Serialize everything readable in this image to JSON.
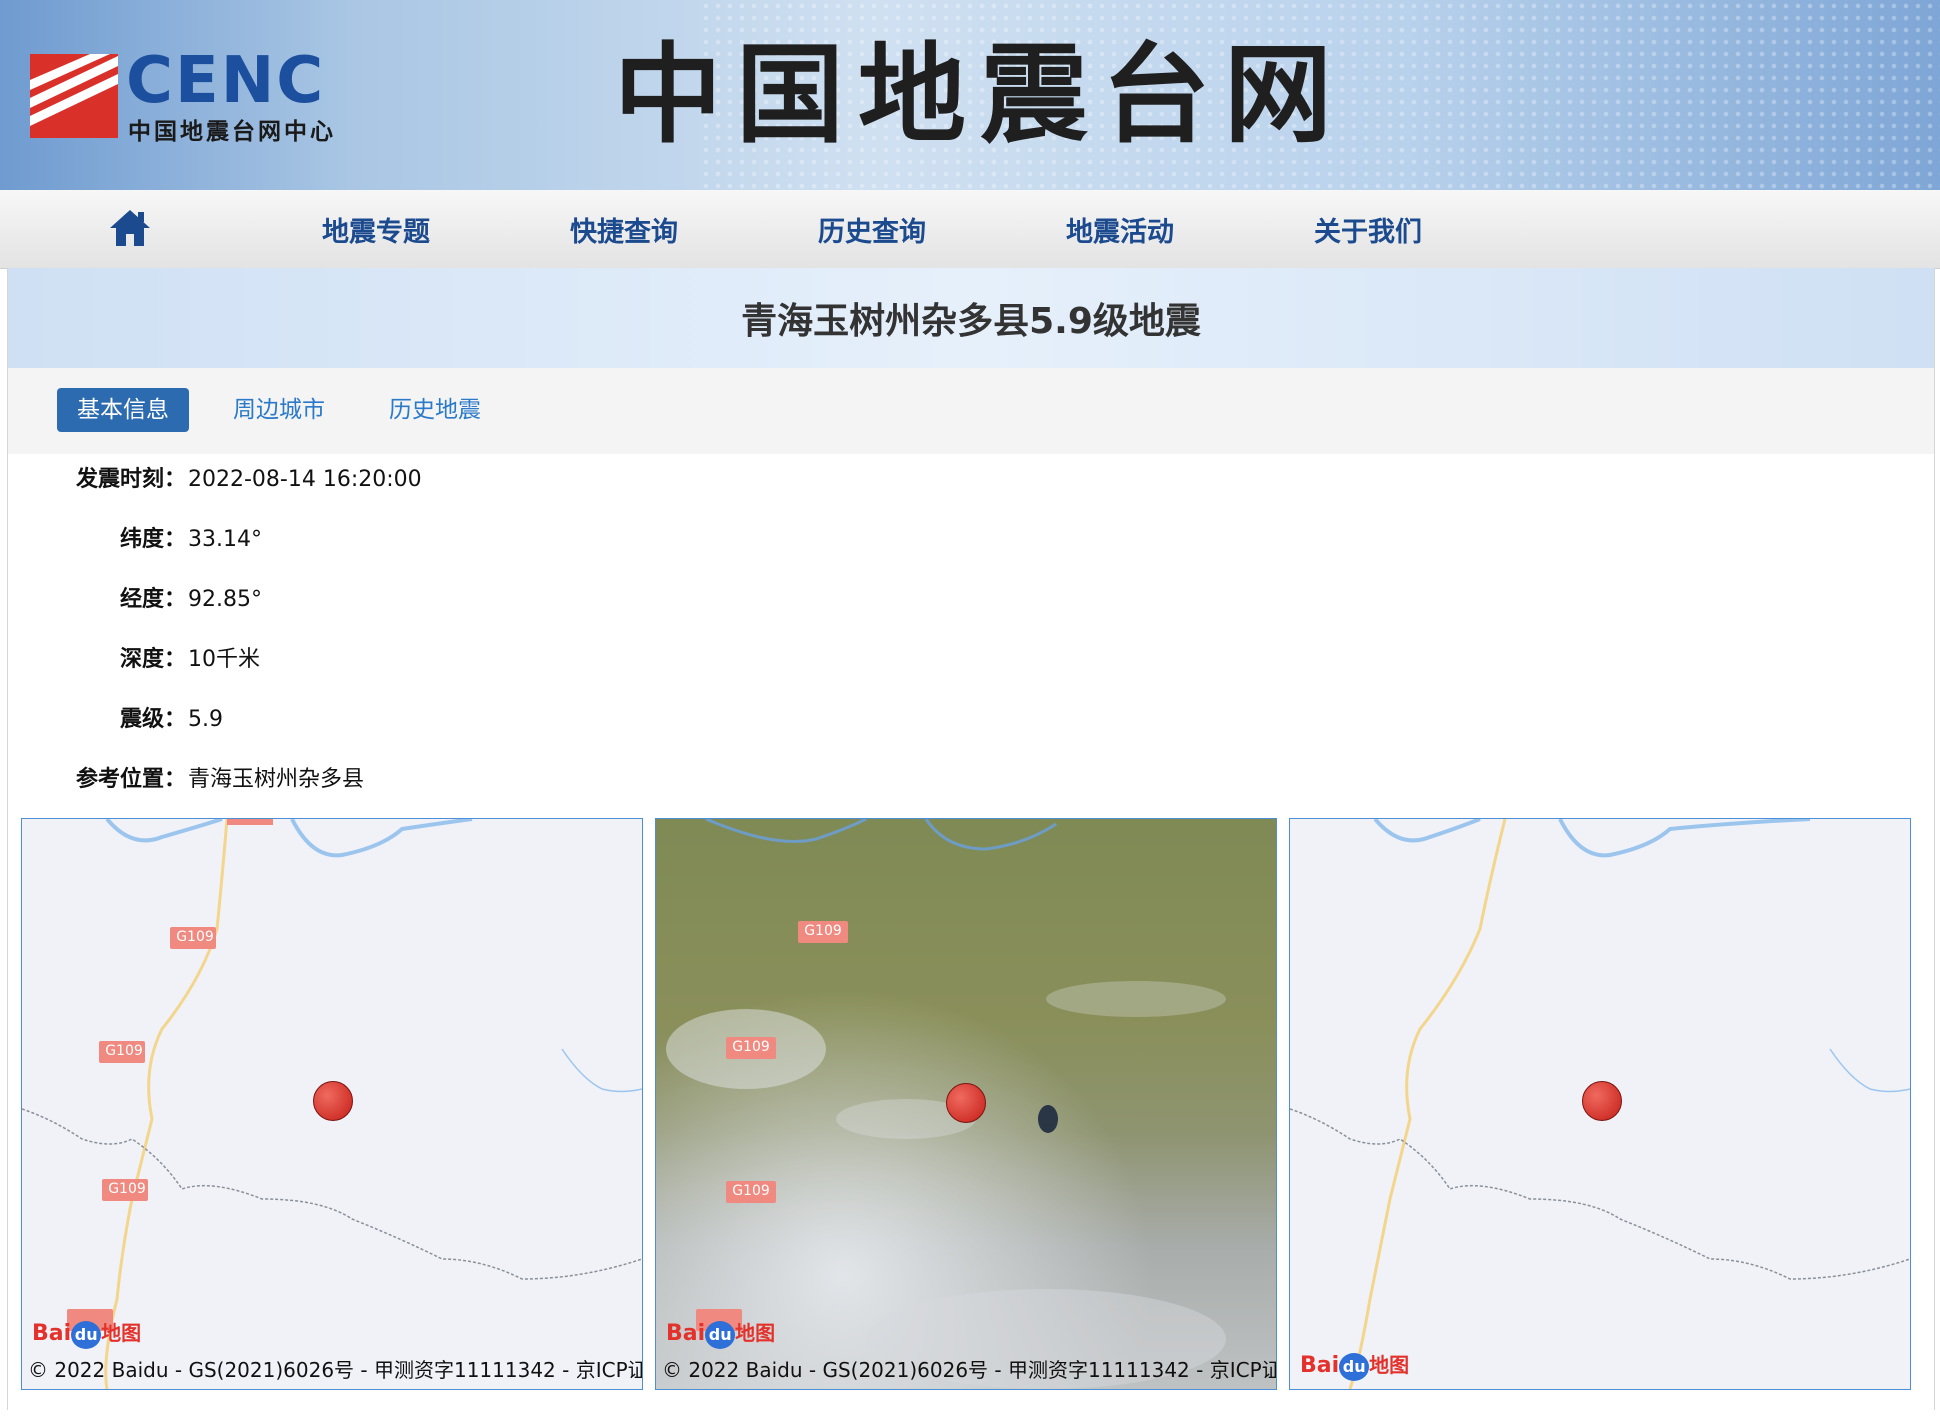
{
  "header": {
    "logo_text": "CENC",
    "logo_subtitle": "中国地震台网中心",
    "site_title": "中国地震台网"
  },
  "nav": {
    "items": [
      {
        "label": "地震专题"
      },
      {
        "label": "快捷查询"
      },
      {
        "label": "历史查询"
      },
      {
        "label": "地震活动"
      },
      {
        "label": "关于我们"
      }
    ]
  },
  "event": {
    "title": "青海玉树州杂多县5.9级地震"
  },
  "tabs": [
    {
      "label": "基本信息",
      "active": true
    },
    {
      "label": "周边城市",
      "active": false
    },
    {
      "label": "历史地震",
      "active": false
    }
  ],
  "info": [
    {
      "label": "发震时刻：",
      "value": "2022-08-14 16:20:00"
    },
    {
      "label": "纬度：",
      "value": "33.14°"
    },
    {
      "label": "经度：",
      "value": "92.85°"
    },
    {
      "label": "深度：",
      "value": "10千米"
    },
    {
      "label": "震级：",
      "value": "5.9"
    },
    {
      "label": "参考位置：",
      "value": "青海玉树州杂多县"
    }
  ],
  "maps": [
    {
      "style": "normal",
      "road_labels": [
        "G109",
        "G109",
        "G109"
      ],
      "copyright": "© 2022 Baidu - GS(2021)6026号 - 甲测资字11111342 - 京ICP证"
    },
    {
      "style": "satellite",
      "road_labels": [
        "G109",
        "G109",
        "G109"
      ],
      "copyright": "© 2022 Baidu - GS(2021)6026号 - 甲测资字11111342 - 京ICP证"
    },
    {
      "style": "normal",
      "road_labels": [],
      "copyright": ""
    }
  ],
  "baidu_logo": {
    "bai": "Bai",
    "du": "du",
    "ditu": "地图"
  },
  "colors": {
    "nav_text": "#1b4a8f",
    "tab_active": "#2c6bb0",
    "tab_text": "#2a7ac9",
    "marker": "#d42a22",
    "map_border": "#4d8fd6"
  }
}
